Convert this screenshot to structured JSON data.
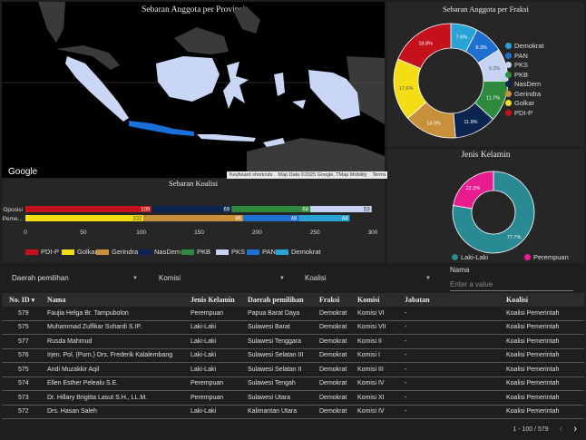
{
  "map": {
    "title": "Sebaran Anggota per Provinsi",
    "google_logo": "Google",
    "attribution": [
      "Keyboard shortcuts",
      "Map Data ©2025 Google, TMap Mobility",
      "Terms"
    ]
  },
  "fraksi_chart": {
    "title": "Sebaran Anggota per Fraksi",
    "legend": [
      "Demokrat",
      "PAN",
      "PKS",
      "PKB",
      "NasDem",
      "Gerindra",
      "Golkar",
      "PDI-P"
    ]
  },
  "gender_chart": {
    "title": "Jenis Kelamin",
    "legend": [
      "Laki-Laki",
      "Perempuan"
    ]
  },
  "koalisi_chart": {
    "title": "Sebaran Koalisi",
    "legend": [
      "PDI-P",
      "Golkar",
      "Gerindra",
      "NasDem",
      "PKB",
      "PKS",
      "PAN",
      "Demokrat"
    ]
  },
  "chart_data": [
    {
      "type": "pie",
      "title": "Sebaran Anggota per Fraksi",
      "donut": true,
      "labels": [
        "Demokrat",
        "PAN",
        "PKS",
        "PKB",
        "NasDem",
        "Gerindra",
        "Golkar",
        "PDI-P"
      ],
      "values": [
        7.6,
        8.3,
        9.2,
        11.7,
        11.9,
        14.9,
        17.6,
        18.8
      ],
      "value_labels": [
        "7.6%",
        "8.3%",
        "9.2%",
        "11.7%",
        "11.9%",
        "14.9%",
        "17.6%",
        "18.8%"
      ],
      "colors": [
        "#29a3d6",
        "#1f6fd1",
        "#c7d3f2",
        "#2e8b3e",
        "#0b2550",
        "#c8903a",
        "#f4dd15",
        "#c4111b"
      ]
    },
    {
      "type": "pie",
      "title": "Jenis Kelamin",
      "donut": true,
      "labels": [
        "Laki-Laki",
        "Perempuan"
      ],
      "values": [
        77.7,
        22.3
      ],
      "value_labels": [
        "77.7%",
        "22.3%"
      ],
      "colors": [
        "#2a8a93",
        "#e81b8f"
      ]
    },
    {
      "type": "bar",
      "orientation": "horizontal",
      "stacked": true,
      "title": "Sebaran Koalisi",
      "categories": [
        "Oposisi",
        "Koalisi Peme..."
      ],
      "xlim": [
        0,
        300
      ],
      "xticks": [
        "0",
        "50",
        "100",
        "150",
        "200",
        "250",
        "300"
      ],
      "series": [
        {
          "name": "PDI-P",
          "values": [
            109,
            0
          ],
          "color": "#c4111b"
        },
        {
          "name": "Golkar",
          "values": [
            0,
            102
          ],
          "color": "#f4dd15"
        },
        {
          "name": "Gerindra",
          "values": [
            0,
            86
          ],
          "color": "#c8903a"
        },
        {
          "name": "NasDem",
          "values": [
            69,
            0
          ],
          "color": "#0b2550"
        },
        {
          "name": "PKB",
          "values": [
            68,
            0
          ],
          "color": "#2e8b3e"
        },
        {
          "name": "PKS",
          "values": [
            53,
            0
          ],
          "color": "#c7d3f2"
        },
        {
          "name": "PAN",
          "values": [
            0,
            48
          ],
          "color": "#1f6fd1"
        },
        {
          "name": "Demokrat",
          "values": [
            0,
            44
          ],
          "color": "#29a3d6"
        }
      ]
    }
  ],
  "filters": {
    "daerah": "Daerah pemilihan",
    "komisi": "Komisi",
    "koalisi": "Koalisi",
    "name_label": "Nama",
    "name_placeholder": "Enter a value"
  },
  "table": {
    "headers": [
      "No. ID",
      "Nama",
      "Jenis Kelamin",
      "Daerah pemilihan",
      "Fraksi",
      "Komisi",
      "Jabatan",
      "Koalisi"
    ],
    "sort_indicator": "▾",
    "rows": [
      [
        "579",
        "Faujia Helga Br. Tampubolon",
        "Perempuan",
        "Papua Barat Daya",
        "Demokrat",
        "Komisi VI",
        "-",
        "Koalisi Pemerintah"
      ],
      [
        "575",
        "Muhammad Zulfikar Suhardi S.IP.",
        "Laki-Laki",
        "Sulawesi Barat",
        "Demokrat",
        "Komisi VII",
        "-",
        "Koalisi Pemerintah"
      ],
      [
        "577",
        "Rusda Mahmud",
        "Laki-Laki",
        "Sulawesi Tenggara",
        "Demokrat",
        "Komisi II",
        "-",
        "Koalisi Pemerintah"
      ],
      [
        "576",
        "Irjen. Pol. (Purn.) Drs. Frederik Kalalembang",
        "Laki-Laki",
        "Sulawesi Selatan III",
        "Demokrat",
        "Komisi I",
        "-",
        "Koalisi Pemerintah"
      ],
      [
        "575",
        "Andi Muzakkir Aqil",
        "Laki-Laki",
        "Sulawesi Selatan II",
        "Demokrat",
        "Komisi III",
        "-",
        "Koalisi Pemerintah"
      ],
      [
        "574",
        "Ellen Esther Pelealu S.E.",
        "Perempuan",
        "Sulawesi Tengah",
        "Demokrat",
        "Komisi IV",
        "-",
        "Koalisi Pemerintah"
      ],
      [
        "573",
        "Dr. Hillary Brigitta Lasut S.H., LL.M.",
        "Perempuan",
        "Sulawesi Utara",
        "Demokrat",
        "Komisi XI",
        "-",
        "Koalisi Pemerintah"
      ],
      [
        "572",
        "Drs. Hasan Saleh",
        "Laki-Laki",
        "Kalimantan Utara",
        "Demokrat",
        "Komisi IV",
        "-",
        "Koalisi Pemerintah"
      ]
    ],
    "pagination": "1 - 100 / 579",
    "prev": "‹",
    "next": "›"
  }
}
